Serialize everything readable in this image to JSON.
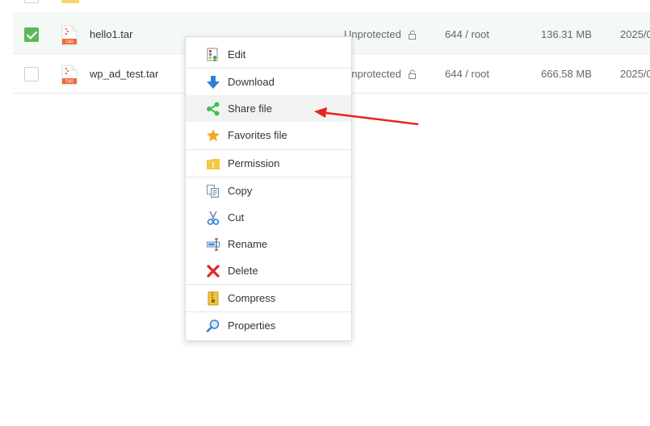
{
  "files": [
    {
      "name": "hello1.tar",
      "protection": "Unprotected",
      "permission": "644 / root",
      "size": "136.31 MB",
      "date": "2025/0",
      "ext": "TAR",
      "checked": true
    },
    {
      "name": "wp_ad_test.tar",
      "protection": "Unprotected",
      "permission": "644 / root",
      "size": "666.58 MB",
      "date": "2025/0",
      "ext": "TAR",
      "checked": false
    }
  ],
  "context_menu": {
    "items": [
      {
        "label": "Edit",
        "icon": "edit-icon"
      },
      {
        "label": "Download",
        "icon": "download-icon"
      },
      {
        "label": "Share file",
        "icon": "share-icon"
      },
      {
        "label": "Favorites file",
        "icon": "star-icon"
      },
      {
        "label": "Permission",
        "icon": "permission-folder-icon"
      },
      {
        "label": "Copy",
        "icon": "copy-icon"
      },
      {
        "label": "Cut",
        "icon": "scissors-icon"
      },
      {
        "label": "Rename",
        "icon": "rename-icon"
      },
      {
        "label": "Delete",
        "icon": "delete-icon"
      },
      {
        "label": "Compress",
        "icon": "zip-icon"
      },
      {
        "label": "Properties",
        "icon": "magnifier-icon"
      }
    ],
    "highlighted": "Share file"
  },
  "annotation": {
    "color": "#e8241f",
    "target": "Share file"
  },
  "colors": {
    "checkbox": "#5cb85c",
    "selected_row": "#f4f9f6",
    "tar_badge": "#f06a3a"
  }
}
